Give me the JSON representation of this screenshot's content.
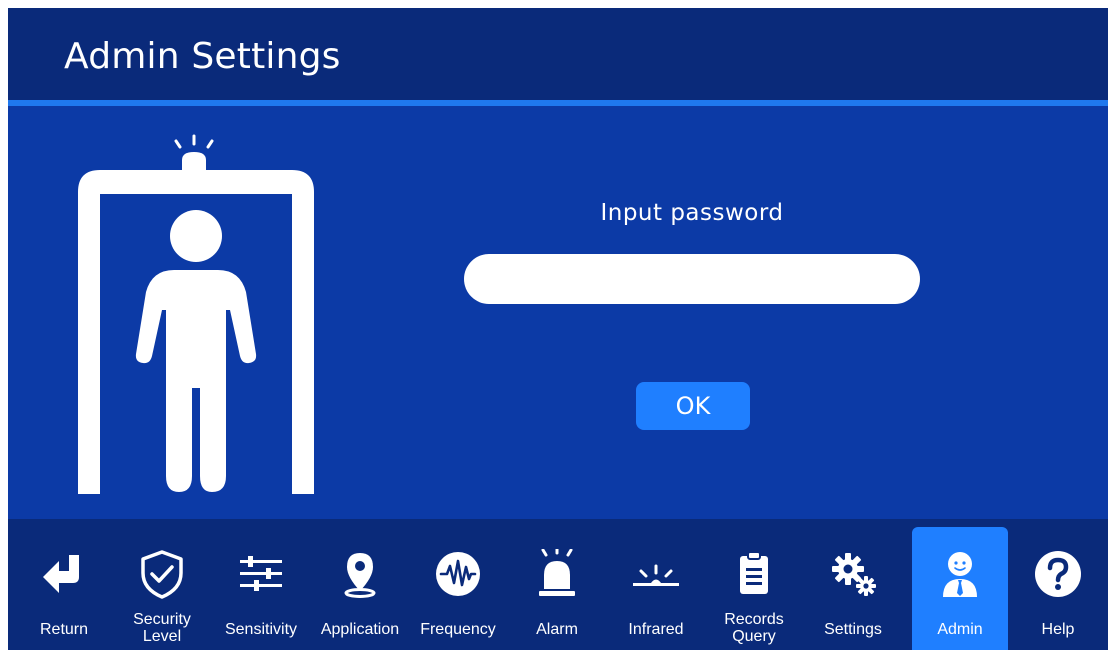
{
  "header": {
    "title": "Admin Settings"
  },
  "form": {
    "prompt": "Input password",
    "password_value": "",
    "ok_label": "OK"
  },
  "nav": {
    "active": "Admin",
    "items": [
      {
        "label": "Return",
        "icon": "return-arrow-icon"
      },
      {
        "label": "Security\nLevel",
        "icon": "shield-check-icon"
      },
      {
        "label": "Sensitivity",
        "icon": "sliders-icon"
      },
      {
        "label": "Application",
        "icon": "location-pin-icon"
      },
      {
        "label": "Frequency",
        "icon": "waveform-icon"
      },
      {
        "label": "Alarm",
        "icon": "alarm-beacon-icon"
      },
      {
        "label": "Infrared",
        "icon": "infrared-icon"
      },
      {
        "label": "Records\nQuery",
        "icon": "clipboard-icon"
      },
      {
        "label": "Settings",
        "icon": "gears-icon"
      },
      {
        "label": "Admin",
        "icon": "admin-user-icon"
      },
      {
        "label": "Help",
        "icon": "help-question-icon"
      }
    ]
  },
  "colors": {
    "background": "#0c3aa6",
    "header": "#0a2a7a",
    "accent": "#1f7fff",
    "divider": "#1f78ee"
  }
}
